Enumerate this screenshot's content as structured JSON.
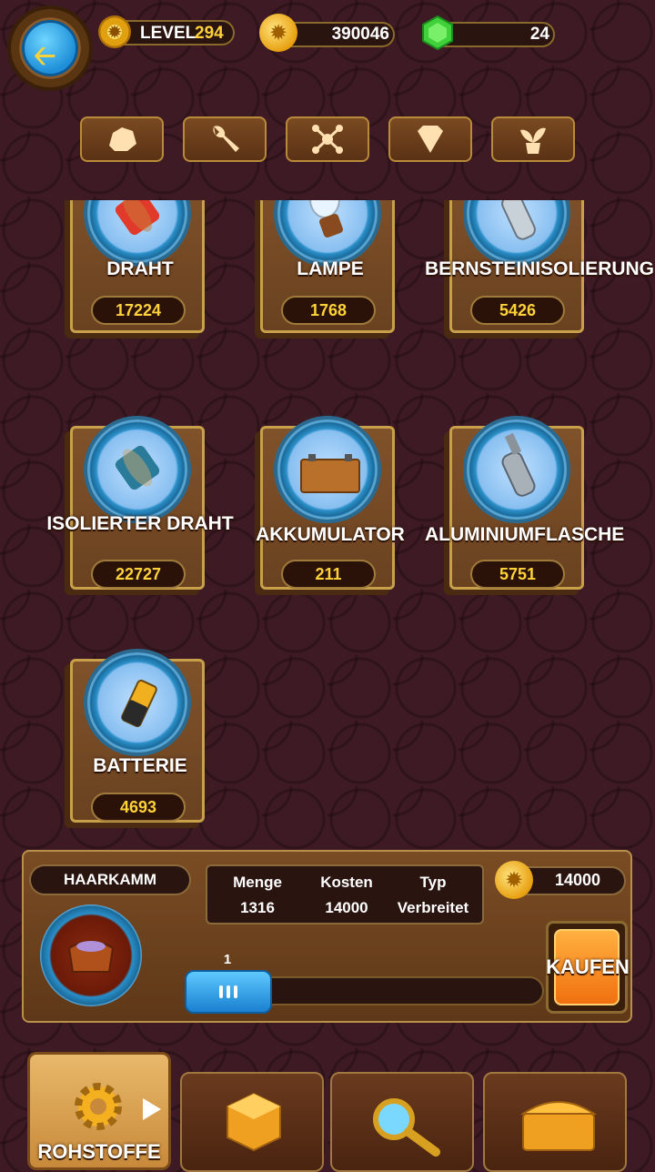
{
  "header": {
    "level_label": "LEVEL",
    "level_value": "294",
    "coins": "390046",
    "gems": "24"
  },
  "categories": [
    {
      "icon": "stone-icon"
    },
    {
      "icon": "wrench-icon"
    },
    {
      "icon": "molecule-icon"
    },
    {
      "icon": "diamond-icon"
    },
    {
      "icon": "plant-icon"
    }
  ],
  "items": [
    {
      "name": "DRAHT",
      "count": "17224",
      "icon": "spool-red-icon"
    },
    {
      "name": "LAMPE",
      "count": "1768",
      "icon": "bulb-icon"
    },
    {
      "name": "BERNSTEINISOLIERUNG",
      "count": "5426",
      "icon": "bottle-icon"
    },
    {
      "name": "ISOLIERTER DRAHT",
      "count": "22727",
      "icon": "spool-blue-icon"
    },
    {
      "name": "AKKUMULATOR",
      "count": "211",
      "icon": "car-battery-icon"
    },
    {
      "name": "ALUMINIUMFLASCHE",
      "count": "5751",
      "icon": "aluminium-bottle-icon"
    },
    {
      "name": "BATTERIE",
      "count": "4693",
      "icon": "battery-icon"
    }
  ],
  "trade": {
    "item_name": "HAARKAMM",
    "menge_label": "Menge",
    "menge_value": "1316",
    "kosten_label": "Kosten",
    "kosten_value": "14000",
    "typ_label": "Typ",
    "typ_value": "Verbreitet",
    "total_cost": "14000",
    "quantity": "1",
    "slider_fraction": 0.0,
    "buy_label": "KAUFEN"
  },
  "nav": {
    "active_label": "ROHSTOFFE",
    "items": [
      "materials-gear-icon",
      "dice-icon",
      "magnifier-icon",
      "chest-icon"
    ]
  },
  "colors": {
    "accent_gold": "#ffd23a",
    "buy_orange": "#f07010",
    "slider_blue": "#1a80d0"
  }
}
